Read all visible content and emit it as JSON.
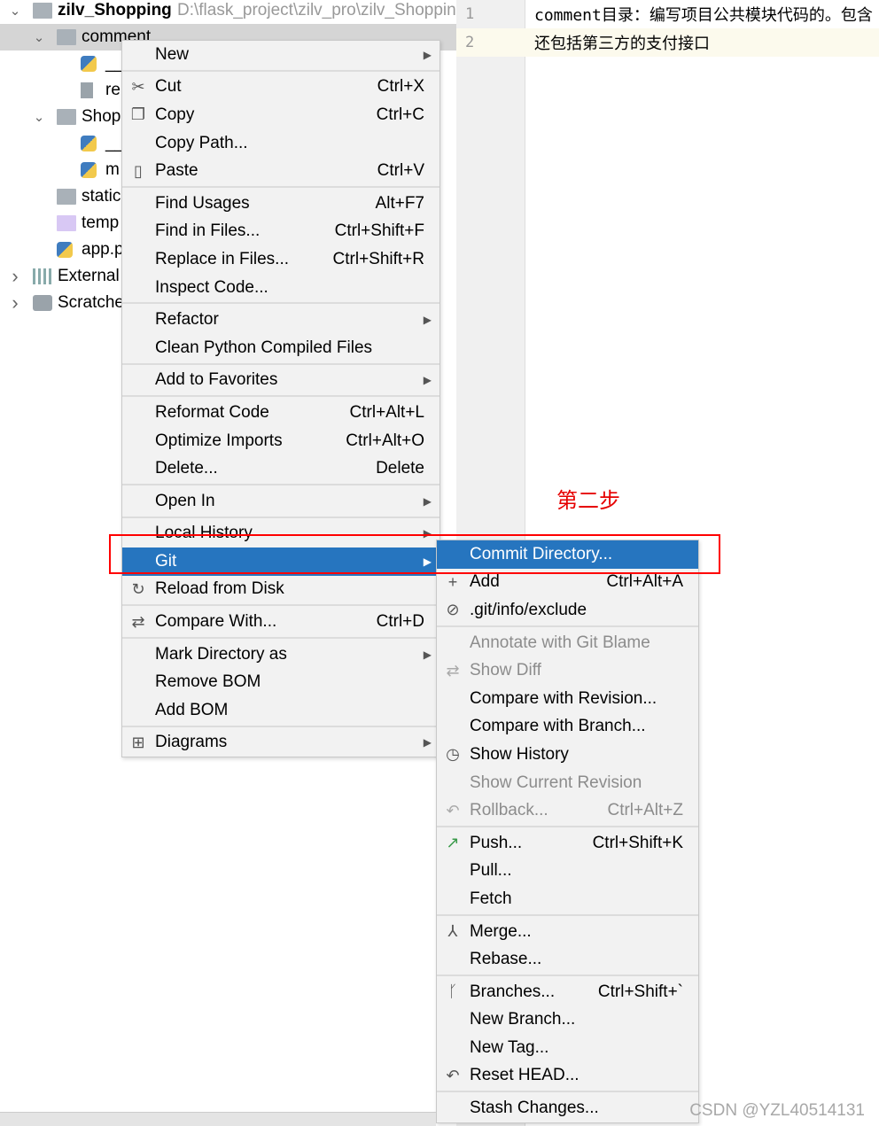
{
  "tree": [
    {
      "label": "zilv_Shopping",
      "path": "D:\\flask_project\\zilv_pro\\zilv_Shoppin",
      "chev": "v",
      "icon": "folder-icon",
      "indent": 0,
      "bold": true
    },
    {
      "label": "comment",
      "chev": "v",
      "icon": "package-folder-icon",
      "indent": 1,
      "selected": true
    },
    {
      "label": "__i",
      "icon": "python-file-icon",
      "indent": 2
    },
    {
      "label": "re",
      "icon": "text-file-icon",
      "indent": 2
    },
    {
      "label": "Shop",
      "chev": "v",
      "icon": "package-folder-icon",
      "indent": 1
    },
    {
      "label": "__i",
      "icon": "python-file-icon",
      "indent": 2
    },
    {
      "label": "m",
      "icon": "python-file-icon",
      "indent": 2
    },
    {
      "label": "static",
      "icon": "folder-icon",
      "indent": 1
    },
    {
      "label": "temp",
      "icon": "templates-folder-icon",
      "indent": 1
    },
    {
      "label": "app.p",
      "icon": "python-file-icon",
      "indent": 1
    },
    {
      "label": "External",
      "chev": ">",
      "icon": "library-icon",
      "indent": 0
    },
    {
      "label": "Scratche",
      "chev": ">",
      "icon": "scratches-icon",
      "indent": 0
    }
  ],
  "editor": {
    "lines": [
      {
        "num": "1",
        "text": "comment目录：编写项目公共模块代码的。包含"
      },
      {
        "num": "2",
        "text": "还包括第三方的支付接口"
      }
    ]
  },
  "context_menu": [
    {
      "label": "New",
      "submenu": true
    },
    "-",
    {
      "label": "Cut",
      "shortcut": "Ctrl+X",
      "icon": "scissors-icon"
    },
    {
      "label": "Copy",
      "shortcut": "Ctrl+C",
      "icon": "copy-icon"
    },
    {
      "label": "Copy Path..."
    },
    {
      "label": "Paste",
      "shortcut": "Ctrl+V",
      "icon": "clipboard-icon"
    },
    "-",
    {
      "label": "Find Usages",
      "shortcut": "Alt+F7"
    },
    {
      "label": "Find in Files...",
      "shortcut": "Ctrl+Shift+F"
    },
    {
      "label": "Replace in Files...",
      "shortcut": "Ctrl+Shift+R"
    },
    {
      "label": "Inspect Code..."
    },
    "-",
    {
      "label": "Refactor",
      "submenu": true
    },
    {
      "label": "Clean Python Compiled Files"
    },
    "-",
    {
      "label": "Add to Favorites",
      "submenu": true
    },
    "-",
    {
      "label": "Reformat Code",
      "shortcut": "Ctrl+Alt+L"
    },
    {
      "label": "Optimize Imports",
      "shortcut": "Ctrl+Alt+O"
    },
    {
      "label": "Delete...",
      "shortcut": "Delete"
    },
    "-",
    {
      "label": "Open In",
      "submenu": true
    },
    "-",
    {
      "label": "Local History",
      "submenu": true
    },
    {
      "label": "Git",
      "submenu": true,
      "highlighted": true
    },
    {
      "label": "Reload from Disk",
      "icon": "reload-icon"
    },
    "-",
    {
      "label": "Compare With...",
      "shortcut": "Ctrl+D",
      "icon": "compare-icon"
    },
    "-",
    {
      "label": "Mark Directory as",
      "submenu": true
    },
    {
      "label": "Remove BOM"
    },
    {
      "label": "Add BOM"
    },
    "-",
    {
      "label": "Diagrams",
      "submenu": true,
      "icon": "diagram-icon"
    }
  ],
  "git_menu": [
    {
      "label": "Commit Directory...",
      "highlighted": true
    },
    {
      "label": "Add",
      "shortcut": "Ctrl+Alt+A",
      "icon": "plus-icon"
    },
    {
      "label": ".git/info/exclude",
      "icon": "ignore-file-icon"
    },
    "-",
    {
      "label": "Annotate with Git Blame",
      "disabled": true
    },
    {
      "label": "Show Diff",
      "disabled": true,
      "icon": "diff-icon"
    },
    {
      "label": "Compare with Revision..."
    },
    {
      "label": "Compare with Branch..."
    },
    {
      "label": "Show History",
      "icon": "clock-icon"
    },
    {
      "label": "Show Current Revision",
      "disabled": true
    },
    {
      "label": "Rollback...",
      "shortcut": "Ctrl+Alt+Z",
      "disabled": true,
      "icon": "rollback-icon"
    },
    "-",
    {
      "label": "Push...",
      "shortcut": "Ctrl+Shift+K",
      "icon": "push-arrow-icon"
    },
    {
      "label": "Pull..."
    },
    {
      "label": "Fetch"
    },
    "-",
    {
      "label": "Merge...",
      "icon": "merge-icon"
    },
    {
      "label": "Rebase..."
    },
    "-",
    {
      "label": "Branches...",
      "shortcut": "Ctrl+Shift+`",
      "icon": "branch-icon"
    },
    {
      "label": "New Branch..."
    },
    {
      "label": "New Tag..."
    },
    {
      "label": "Reset HEAD...",
      "icon": "reset-icon"
    },
    "-",
    {
      "label": "Stash Changes..."
    }
  ],
  "annotation": {
    "step_label": "第二步",
    "highlight_color": "#ff0000"
  },
  "watermark": "CSDN @YZL40514131",
  "colors": {
    "selection": "#2675bf",
    "menu_bg": "#f2f2f2"
  }
}
